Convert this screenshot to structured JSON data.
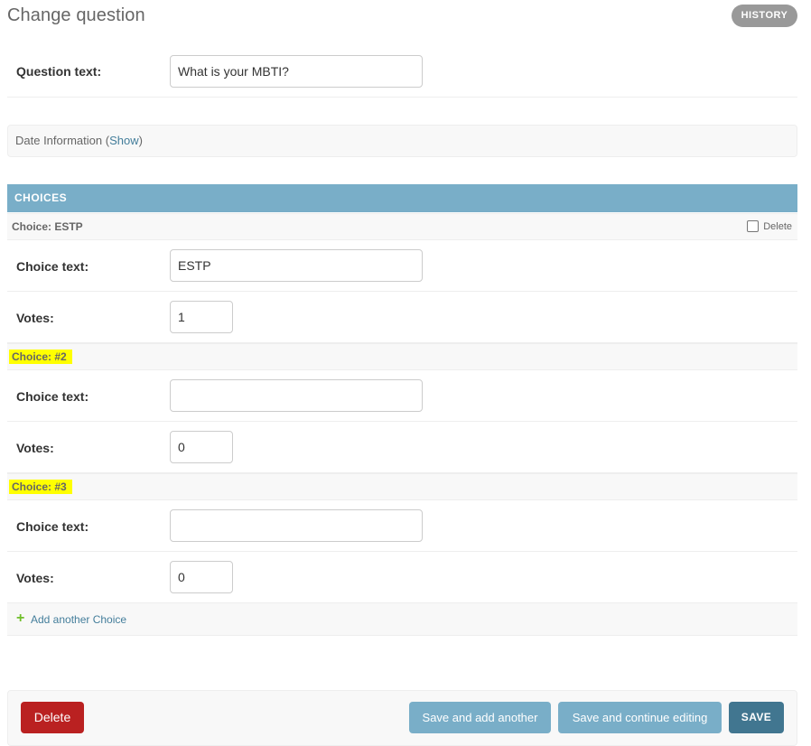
{
  "page": {
    "title": "Change question",
    "history_label": "HISTORY"
  },
  "question": {
    "label": "Question text:",
    "value": "What is your MBTI?"
  },
  "date_info": {
    "label": "Date Information",
    "open_paren": " (",
    "show_label": "Show",
    "close_paren": ")"
  },
  "choices": {
    "header": "CHOICES",
    "delete_label": "Delete",
    "field_labels": {
      "choice_text": "Choice text:",
      "votes": "Votes:"
    },
    "items": [
      {
        "title": "Choice: ESTP",
        "choice_text": "ESTP",
        "votes": "1",
        "highlighted": false,
        "has_delete": true
      },
      {
        "title": "Choice: #2",
        "choice_text": "",
        "votes": "0",
        "highlighted": true,
        "has_delete": false
      },
      {
        "title": "Choice: #3",
        "choice_text": "",
        "votes": "0",
        "highlighted": true,
        "has_delete": false
      }
    ],
    "add_label": "Add another Choice",
    "add_icon": "plus-icon"
  },
  "submit": {
    "delete_label": "Delete",
    "save_add_label": "Save and add another",
    "save_continue_label": "Save and continue editing",
    "save_label": "SAVE"
  },
  "colors": {
    "module_header": "#79aec8",
    "delete_button": "#ba2121",
    "save_button": "#417690",
    "link": "#447e9b",
    "highlight": "#ffff00",
    "add_icon": "#70bf2b"
  }
}
